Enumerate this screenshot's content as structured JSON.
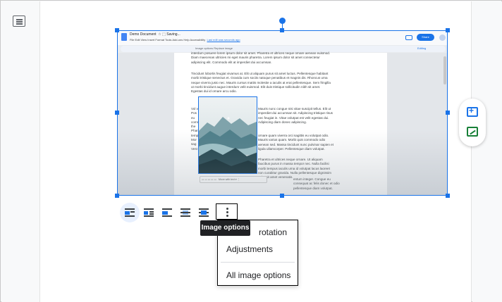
{
  "embedded_doc": {
    "title": "Demo Document",
    "saving": "Saving...",
    "menu": "File  Edit  View  Insert  Format  Tools  Add-ons  Help  Accessibility",
    "last_edit": "Last edit was seconds ago",
    "share": "Share",
    "toolbar_text": "Image options     Replace image",
    "editing": "Editing",
    "para1": "interdum posuere lorem ipsum dolor sit amet. Pharetra et ultrices neque ornare aenean euismod. Diam maecenas ultricies mi eget mauris pharetra. Lorem ipsum dolor sit amet consectetur adipiscing elit. Commodo elit at imperdiet dui accumsan.",
    "para2": "Tincidunt lobortis feugiat vivamus at. Elit ut aliquam purus sit amet luctus. Pellentesque habitant morbi tristique senectus et. Gravida cum sociis natoque penatibus et magnis dis. Rhoncus urna neque viverra justo nec. Mauris cursus mattis molestie a iaculis at erat pellentesque. Sem fringilla ut morbi tincidunt augue interdum velit euismod. Elit duis tristique sollicitudin nibh sit amet. Egestas dui id ornare arcu odio.",
    "para3": "Mauris nunc congue nisi vitae suscipit tellus. Elit ut imperdiet dui accumsan sit. Adipiscing tristique risus nec feugiat in. Vitae volutpat est velit egestas dui. Adipiscing diam donec adipiscing.",
    "para4": "ornare quam viverra orci sagittis eu volutpat odio. Mauris varius quam. Morbi quis commodo odio aenean sed. Massa tincidunt nunc pulvinar sapien et ligula ullamcorper. Pellentesque diam volutpat.",
    "para5": "Pharetra et ultrices neque ornare. Ut aliquam faucibus purus in massa tempor nec. Nulla facilisi morbi tempus iaculis urna id volutpat lacus laoreet non curabitur gravida. Nulla pellentesque dignissim enim sit amet venenatis.",
    "para6": "entum integer. Congue eu consequat ac felis donec et odio pellentesque diam volutpat.",
    "left_frag": "Vol vol Pos eu comm the Phar temp Mor sag Vest",
    "image_bar": "Move with text"
  },
  "image_toolbar": {
    "wrap_options": [
      "In line",
      "Wrap text",
      "Break text",
      "Behind text",
      "In front of text"
    ],
    "more_label": "Image options"
  },
  "tooltip": "Image options",
  "menu": {
    "items": [
      "rotation",
      "Adjustments",
      "All image options"
    ]
  }
}
